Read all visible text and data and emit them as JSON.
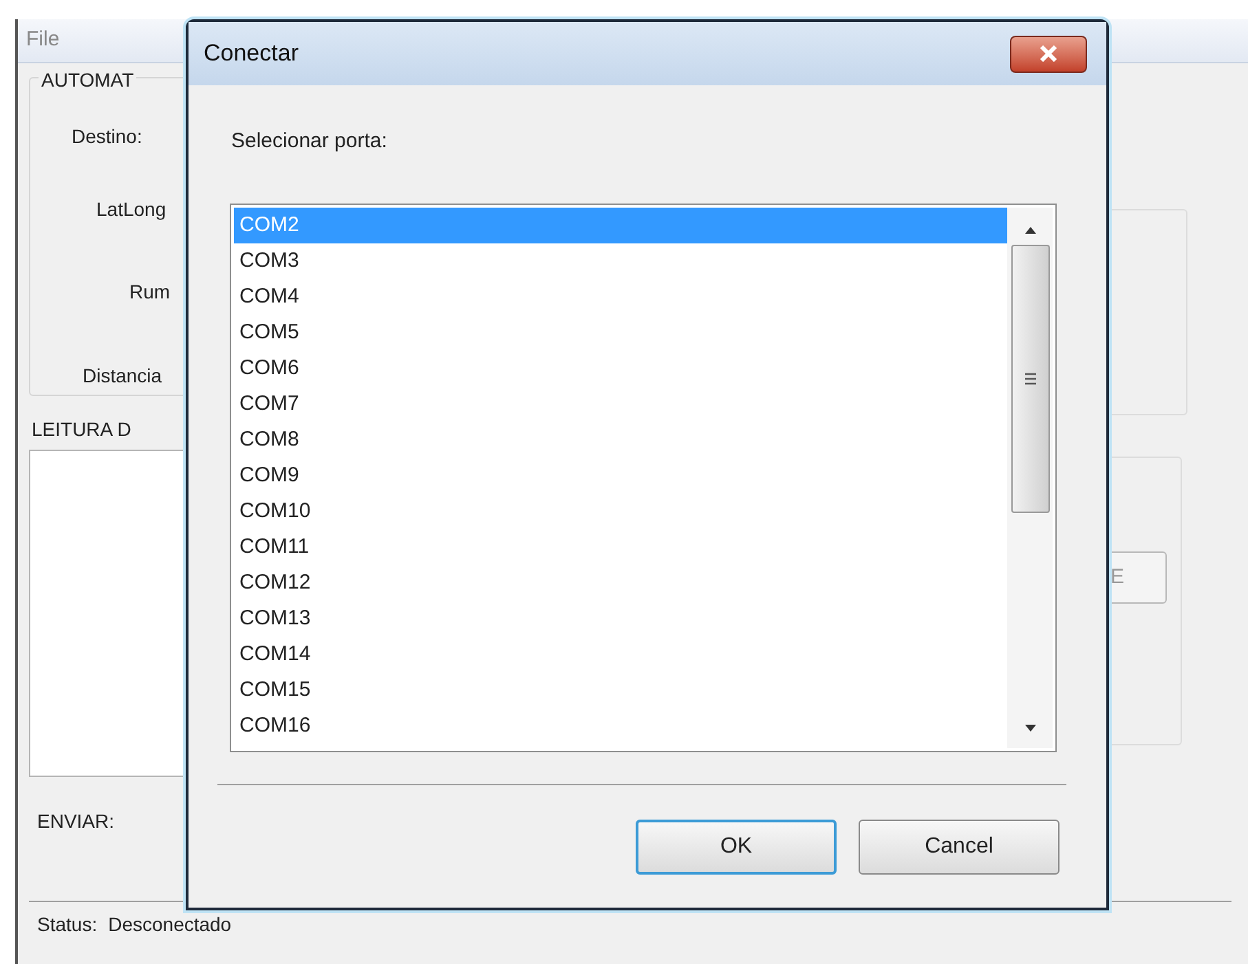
{
  "main_window": {
    "menu": [
      {
        "label": "File"
      }
    ],
    "automation_group": {
      "title": "AUTOMAT",
      "fields": [
        {
          "label": "Destino:"
        },
        {
          "label": "LatLong"
        },
        {
          "label": "Rum"
        },
        {
          "label": "Distancia"
        }
      ]
    },
    "reading_group": {
      "title": "LEITURA D"
    },
    "send": {
      "label": "ENVIAR:"
    },
    "side_button": {
      "label": "E"
    },
    "status": {
      "label": "Status:",
      "value": "Desconectado"
    }
  },
  "dialog": {
    "title": "Conectar",
    "prompt": "Selecionar porta:",
    "ports": [
      {
        "label": "COM2",
        "selected": true
      },
      {
        "label": "COM3",
        "selected": false
      },
      {
        "label": "COM4",
        "selected": false
      },
      {
        "label": "COM5",
        "selected": false
      },
      {
        "label": "COM6",
        "selected": false
      },
      {
        "label": "COM7",
        "selected": false
      },
      {
        "label": "COM8",
        "selected": false
      },
      {
        "label": "COM9",
        "selected": false
      },
      {
        "label": "COM10",
        "selected": false
      },
      {
        "label": "COM11",
        "selected": false
      },
      {
        "label": "COM12",
        "selected": false
      },
      {
        "label": "COM13",
        "selected": false
      },
      {
        "label": "COM14",
        "selected": false
      },
      {
        "label": "COM15",
        "selected": false
      },
      {
        "label": "COM16",
        "selected": false
      }
    ],
    "buttons": [
      {
        "label": "OK",
        "focused": true
      },
      {
        "label": "Cancel",
        "focused": false
      }
    ]
  }
}
